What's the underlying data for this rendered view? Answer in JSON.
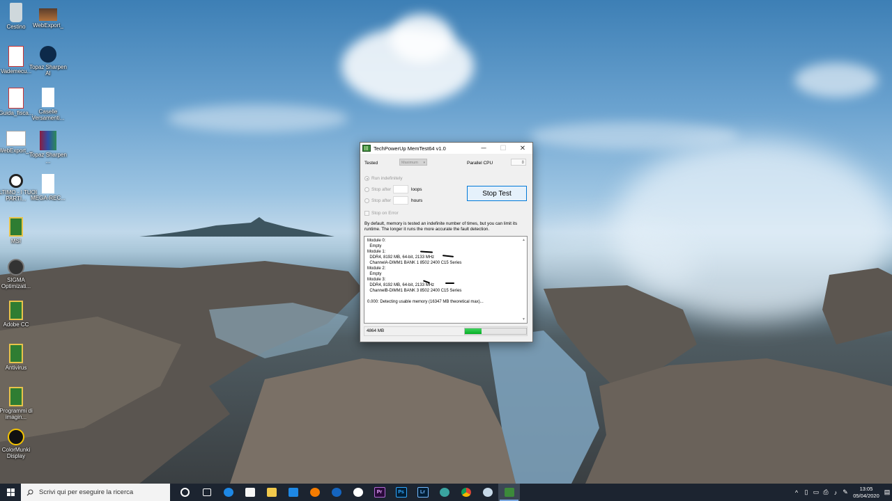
{
  "desktop": {
    "icons": [
      {
        "label": "Cestino",
        "icon": "recycle-bin-icon"
      },
      {
        "label": "WebExport_",
        "icon": "photo-shortcut-icon"
      },
      {
        "label": "Vademecu...",
        "icon": "pdf-file-icon"
      },
      {
        "label": "Topaz Sharpen AI",
        "icon": "topaz-sharpen-icon"
      },
      {
        "label": "Guida_fisca...",
        "icon": "pdf-file-icon"
      },
      {
        "label": "Caselle Versamenti...",
        "icon": "blank-file-icon"
      },
      {
        "label": "WebExport_...",
        "icon": "image-file-icon"
      },
      {
        "label": "Topaz Sharpen ...",
        "icon": "winrar-archive-icon"
      },
      {
        "label": "ULTIMO - I TUOI PARTI...",
        "icon": "media-file-icon"
      },
      {
        "label": "MEGA-REC...",
        "icon": "blank-file-icon"
      },
      {
        "label": "MSI",
        "icon": "folder-shortcut-icon"
      },
      {
        "label": "SIGMA Optimizati...",
        "icon": "sigma-lens-icon"
      },
      {
        "label": "Adobe CC",
        "icon": "folder-shortcut-icon"
      },
      {
        "label": "Antivirus",
        "icon": "folder-shortcut-icon"
      },
      {
        "label": "Programmi di imagin...",
        "icon": "folder-shortcut-icon"
      },
      {
        "label": "ColorMunki Display",
        "icon": "colormunki-icon"
      }
    ]
  },
  "window": {
    "title": "TechPowerUp MemTest64 v1.0",
    "controls": {
      "minimize": "─",
      "maximize": "☐",
      "close": "✕"
    },
    "tested_label": "Tested",
    "tested_value": "Maximum",
    "parallel_cpu_label": "Parallel CPU",
    "parallel_cpu_value": "8",
    "run_indefinitely": "Run indefinitely",
    "stop_after_1": "Stop after",
    "loops_label": "loops",
    "stop_after_2": "Stop after",
    "hours_label": "hours",
    "stop_on_error": "Stop on Error",
    "stop_button": "Stop Test",
    "description": "By default, memory is tested an indefinite number of times, but you can limit its runtime. The longer it runs the more accurate the fault detection.",
    "log_lines": [
      "Module 0:",
      "  Empty",
      "Module 1:",
      "  DDR4, 8192 MB, 64-bit, 2133 MHz",
      "  ChannelA-DIMM1 BANK 1 8502 2400 C15 Series",
      "Module 2:",
      "  Empty",
      "Module 3:",
      "  DDR4, 8192 MB, 64-bit, 2133 MHz",
      "  ChannelB-DIMM1 BANK 3 8502 2400 C15 Series",
      "",
      "0.000: Detecting usable memory (16347 MB theoretical max)..."
    ],
    "memory_value": "4864 MB",
    "progress_fraction": 0.27
  },
  "taskbar": {
    "search_placeholder": "Scrivi qui per eseguire la ricerca",
    "apps": [
      {
        "name": "cortana-icon"
      },
      {
        "name": "task-view-icon"
      },
      {
        "name": "edge-icon"
      },
      {
        "name": "store-icon"
      },
      {
        "name": "file-explorer-icon"
      },
      {
        "name": "mail-icon"
      },
      {
        "name": "vpn-icon"
      },
      {
        "name": "teamviewer-icon"
      },
      {
        "name": "teams-icon"
      },
      {
        "name": "premiere-icon",
        "text": "Pr"
      },
      {
        "name": "photoshop-icon",
        "text": "Ps"
      },
      {
        "name": "lightroom-icon",
        "text": "Lr"
      },
      {
        "name": "app-icon"
      },
      {
        "name": "chrome-icon"
      },
      {
        "name": "app2-icon"
      },
      {
        "name": "memtest-icon"
      }
    ],
    "time": "13:05",
    "date": "05/04/2020"
  },
  "colors": {
    "accent": "#0078d7",
    "progress": "#06b025",
    "taskbar": "#1c2430"
  }
}
